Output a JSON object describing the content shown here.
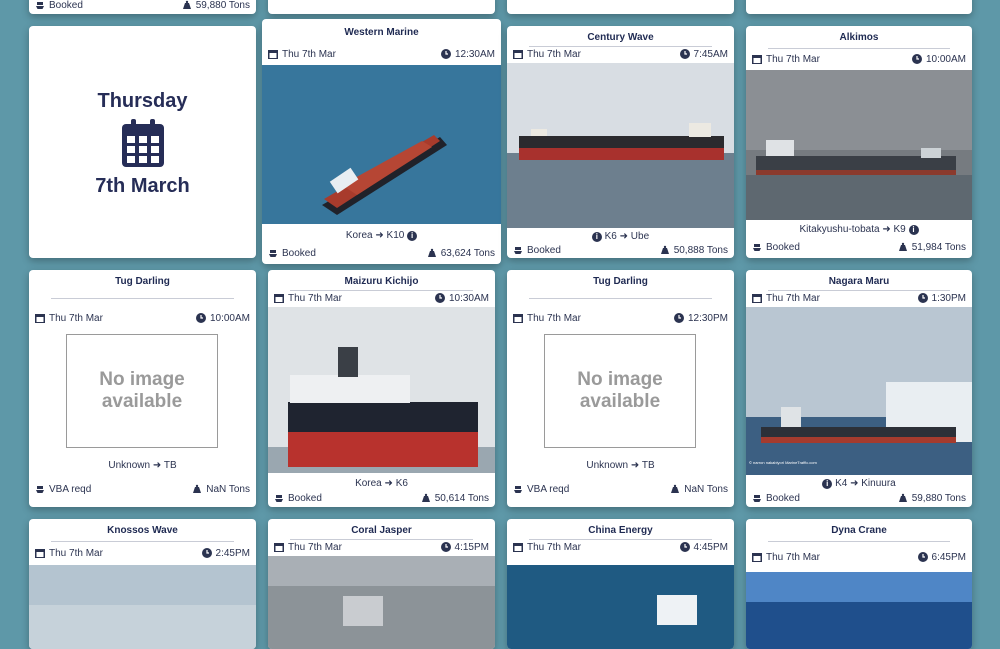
{
  "top_partial": {
    "status": "Booked",
    "tonnage": "59,880 Tons"
  },
  "day_header": {
    "weekday": "Thursday",
    "date": "7th March"
  },
  "cards": [
    {
      "name": "Western Marine",
      "date": "Thu 7th Mar",
      "time": "12:30AM",
      "route_from": "Korea",
      "route_to": "K10",
      "route_info_pos": "after",
      "status": "Booked",
      "tonnage": "63,624 Tons",
      "image": "ship"
    },
    {
      "name": "Century Wave",
      "date": "Thu 7th Mar",
      "time": "7:45AM",
      "route_from": "K6",
      "route_to": "Ube",
      "route_info_pos": "before",
      "status": "Booked",
      "tonnage": "50,888 Tons",
      "image": "ship"
    },
    {
      "name": "Alkimos",
      "date": "Thu 7th Mar",
      "time": "10:00AM",
      "route_from": "Kitakyushu-tobata",
      "route_to": "K9",
      "route_info_pos": "after",
      "status": "Booked",
      "tonnage": "51,984 Tons",
      "image": "ship"
    },
    {
      "name": "Tug Darling",
      "date": "Thu 7th Mar",
      "time": "10:00AM",
      "route_from": "Unknown",
      "route_to": "TB",
      "route_info_pos": "none",
      "status": "VBA reqd",
      "tonnage": "NaN Tons",
      "image": "none"
    },
    {
      "name": "Maizuru Kichijo",
      "date": "Thu 7th Mar",
      "time": "10:30AM",
      "route_from": "Korea",
      "route_to": "K6",
      "route_info_pos": "none",
      "status": "Booked",
      "tonnage": "50,614 Tons",
      "image": "ship"
    },
    {
      "name": "Tug Darling",
      "date": "Thu 7th Mar",
      "time": "12:30PM",
      "route_from": "Unknown",
      "route_to": "TB",
      "route_info_pos": "none",
      "status": "VBA reqd",
      "tonnage": "NaN Tons",
      "image": "none"
    },
    {
      "name": "Nagara Maru",
      "date": "Thu 7th Mar",
      "time": "1:30PM",
      "route_from": "K4",
      "route_to": "Kinuura",
      "route_info_pos": "before",
      "status": "Booked",
      "tonnage": "59,880 Tons",
      "image": "ship"
    },
    {
      "name": "Knossos Wave",
      "date": "Thu 7th Mar",
      "time": "2:45PM",
      "image": "ship"
    },
    {
      "name": "Coral Jasper",
      "date": "Thu 7th Mar",
      "time": "4:15PM",
      "image": "ship"
    },
    {
      "name": "China Energy",
      "date": "Thu 7th Mar",
      "time": "4:45PM",
      "image": "ship"
    },
    {
      "name": "Dyna Crane",
      "date": "Thu 7th Mar",
      "time": "6:45PM",
      "image": "ship"
    }
  ],
  "no_image_text": "No image available",
  "photo_credit": "© narron nakabiyori MarineTraffic.com",
  "colors": {
    "background": "#5e98a8",
    "accent": "#262d57"
  }
}
